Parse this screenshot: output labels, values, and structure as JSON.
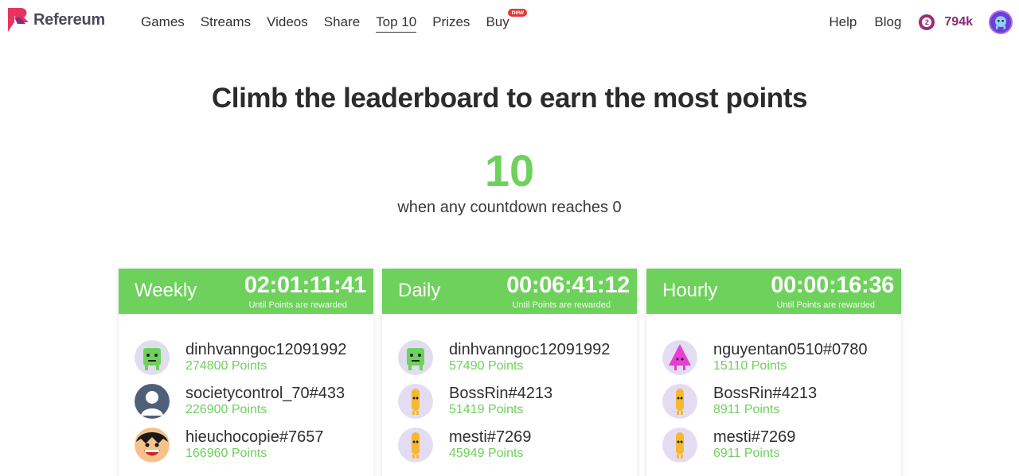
{
  "brand": {
    "name": "Refereum",
    "color": "#e6345e"
  },
  "nav": {
    "items": [
      {
        "label": "Games"
      },
      {
        "label": "Streams"
      },
      {
        "label": "Videos"
      },
      {
        "label": "Share"
      },
      {
        "label": "Top 10",
        "active": true
      },
      {
        "label": "Prizes"
      },
      {
        "label": "Buy",
        "badge": "new"
      }
    ]
  },
  "right": {
    "help": "Help",
    "blog": "Blog",
    "coin_symbol": "2",
    "points": "794k"
  },
  "hero": {
    "title": "Climb the leaderboard to earn the most points",
    "number": "10",
    "subtitle": "when any countdown reaches 0"
  },
  "colors": {
    "accent": "#6ed15c",
    "points": "#8e2a78"
  },
  "boards": [
    {
      "name": "Weekly",
      "timer": "02:01:11:41",
      "note": "Until Points are rewarded",
      "entries": [
        {
          "name": "dinhvanngoc12091992",
          "points": "274800 Points",
          "avatar": "green-block-avatar"
        },
        {
          "name": "societycontrol_70#433",
          "points": "226900 Points",
          "avatar": "default-person-avatar"
        },
        {
          "name": "hieuchocopie#7657",
          "points": "166960 Points",
          "avatar": "cartoon-face-avatar"
        }
      ]
    },
    {
      "name": "Daily",
      "timer": "00:06:41:12",
      "note": "Until Points are rewarded",
      "entries": [
        {
          "name": "dinhvanngoc12091992",
          "points": "57490 Points",
          "avatar": "green-block-avatar"
        },
        {
          "name": "BossRin#4213",
          "points": "51419 Points",
          "avatar": "yellow-stick-avatar"
        },
        {
          "name": "mesti#7269",
          "points": "45949 Points",
          "avatar": "yellow-stick-avatar"
        }
      ]
    },
    {
      "name": "Hourly",
      "timer": "00:00:16:36",
      "note": "Until Points are rewarded",
      "entries": [
        {
          "name": "nguyentan0510#0780",
          "points": "15110 Points",
          "avatar": "pink-triangle-avatar"
        },
        {
          "name": "BossRin#4213",
          "points": "8911 Points",
          "avatar": "yellow-stick-avatar"
        },
        {
          "name": "mesti#7269",
          "points": "6911 Points",
          "avatar": "yellow-stick-avatar"
        }
      ]
    }
  ]
}
